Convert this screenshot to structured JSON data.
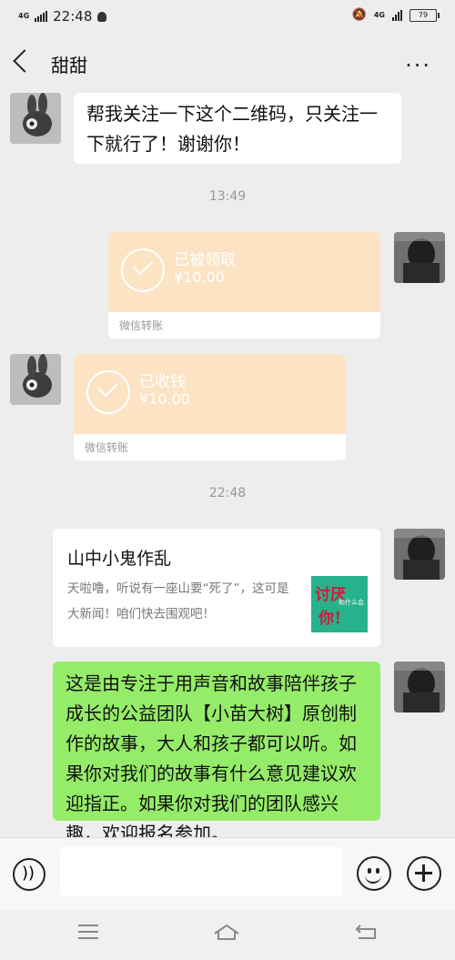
{
  "status_bar": {
    "network": "4G",
    "time": "22:48",
    "network_right": "4G",
    "battery": "79"
  },
  "header": {
    "title": "甜甜"
  },
  "messages": {
    "m1": {
      "text": "帮我关注一下这个二维码，只关注一下就行了！谢谢你！"
    },
    "t1": "13:49",
    "transfer1": {
      "status": "已被领取",
      "amount": "¥10.00",
      "label": "微信转账"
    },
    "transfer2": {
      "status": "已收钱",
      "amount": "¥10.00",
      "label": "微信转账"
    },
    "t2": "22:48",
    "card": {
      "title": "山中小鬼作乱",
      "desc": "天啦噜，听说有一座山要“死了”，这可是大新闻！咱们快去围观吧！",
      "thumb_text1": "讨厌",
      "thumb_text2": "你！",
      "thumb_small": "和什么会"
    },
    "m2": {
      "text": "这是由专注于用声音和故事陪伴孩子成长的公益团队【小苗大树】原创制作的故事，大人和孩子都可以听。如果你对我们的故事有什么意见建议欢迎指正。如果你对我们的团队感兴趣，欢迎报名参加。"
    }
  },
  "input_bar": {
    "placeholder": ""
  }
}
